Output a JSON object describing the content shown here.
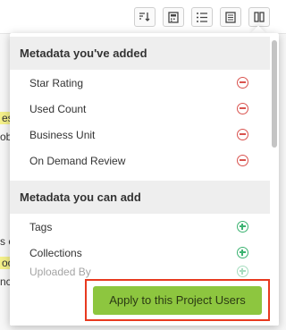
{
  "background": {
    "fragments": [
      "es",
      "ob",
      "s c",
      "oo",
      "nc"
    ]
  },
  "toolbar": {
    "icons": [
      "sort-icon",
      "calculator-icon",
      "list-icon",
      "document-icon",
      "columns-icon"
    ]
  },
  "popup": {
    "added": {
      "header": "Metadata you've added",
      "items": [
        {
          "label": "Star Rating",
          "icon": "remove-circle-icon"
        },
        {
          "label": "Used Count",
          "icon": "remove-circle-icon"
        },
        {
          "label": "Business Unit",
          "icon": "remove-circle-icon"
        },
        {
          "label": "On Demand Review",
          "icon": "remove-circle-icon"
        }
      ]
    },
    "available": {
      "header": "Metadata you can add",
      "items": [
        {
          "label": "Tags",
          "icon": "add-circle-icon"
        },
        {
          "label": "Collections",
          "icon": "add-circle-icon"
        },
        {
          "label": "Uploaded By",
          "icon": "add-circle-icon"
        }
      ]
    },
    "apply_label": "Apply to this Project Users"
  },
  "colors": {
    "remove": "#d9534f",
    "add": "#3cb371",
    "apply_button": "#8dc63f",
    "highlight_border": "#e8391f"
  }
}
